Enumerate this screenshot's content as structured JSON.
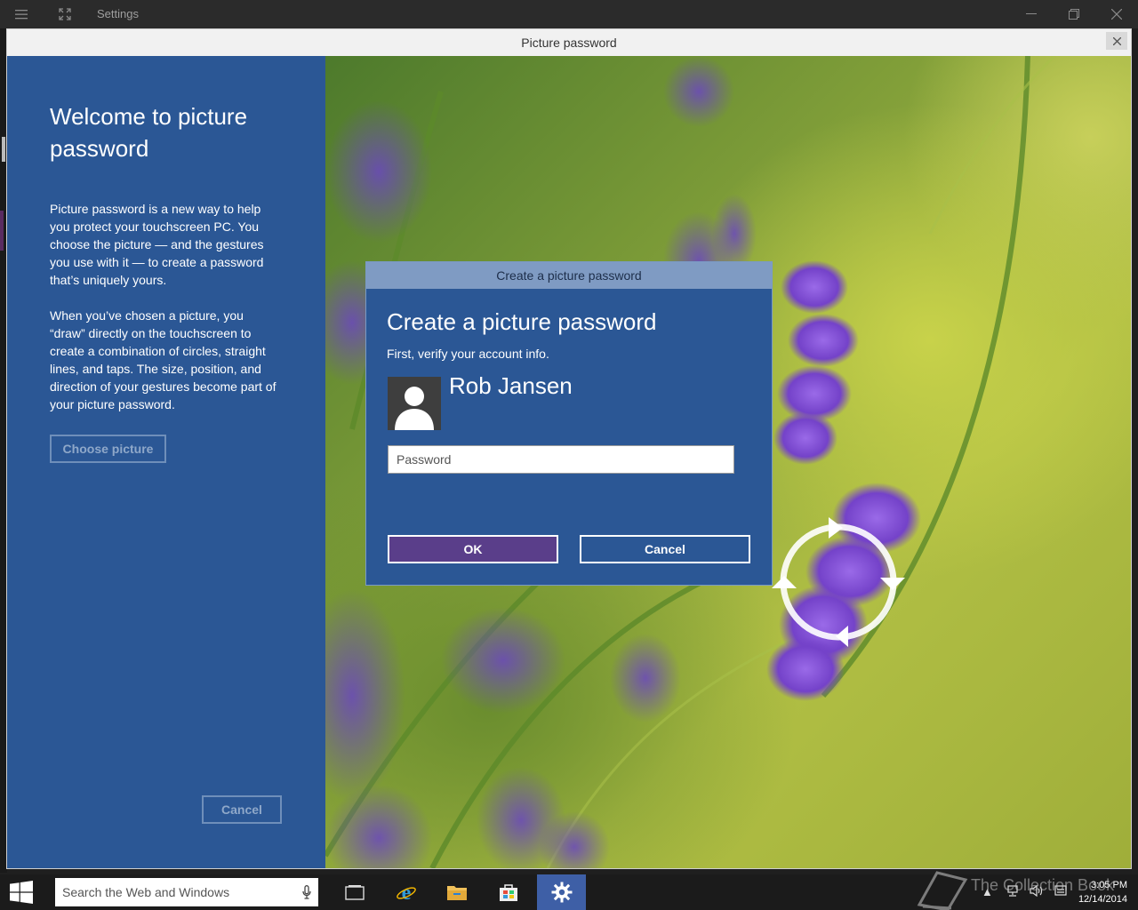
{
  "app": {
    "title": "Settings"
  },
  "dialog_window": {
    "title": "Picture password",
    "close_label": "✕"
  },
  "sidebar": {
    "heading": "Welcome to picture password",
    "paragraph1": "Picture password is a new way to help you protect your touchscreen PC. You choose the picture — and the gestures you use with it — to create a password that’s uniquely yours.",
    "paragraph2": "When you’ve chosen a picture, you “draw” directly on the touchscreen to create a combination of circles, straight lines, and taps. The size, position, and direction of your gestures become part of your picture password.",
    "choose_button": "Choose picture",
    "cancel_button": "Cancel"
  },
  "create_dialog": {
    "title_bar": "Create a picture password",
    "heading": "Create a picture password",
    "subtitle": "First, verify your account info.",
    "username": "Rob Jansen",
    "password_placeholder": "Password",
    "ok_button": "OK",
    "cancel_button": "Cancel"
  },
  "taskbar": {
    "search_placeholder": "Search the Web and Windows",
    "time": "3:05 PM",
    "date": "12/14/2014",
    "apps": [
      "task-view",
      "internet-explorer",
      "file-explorer",
      "store",
      "settings"
    ]
  },
  "watermark": "The Collection Book",
  "colors": {
    "accent_blue": "#2b5795",
    "ok_purple": "#5a3e8a",
    "taskbar": "#1b1b1b"
  }
}
